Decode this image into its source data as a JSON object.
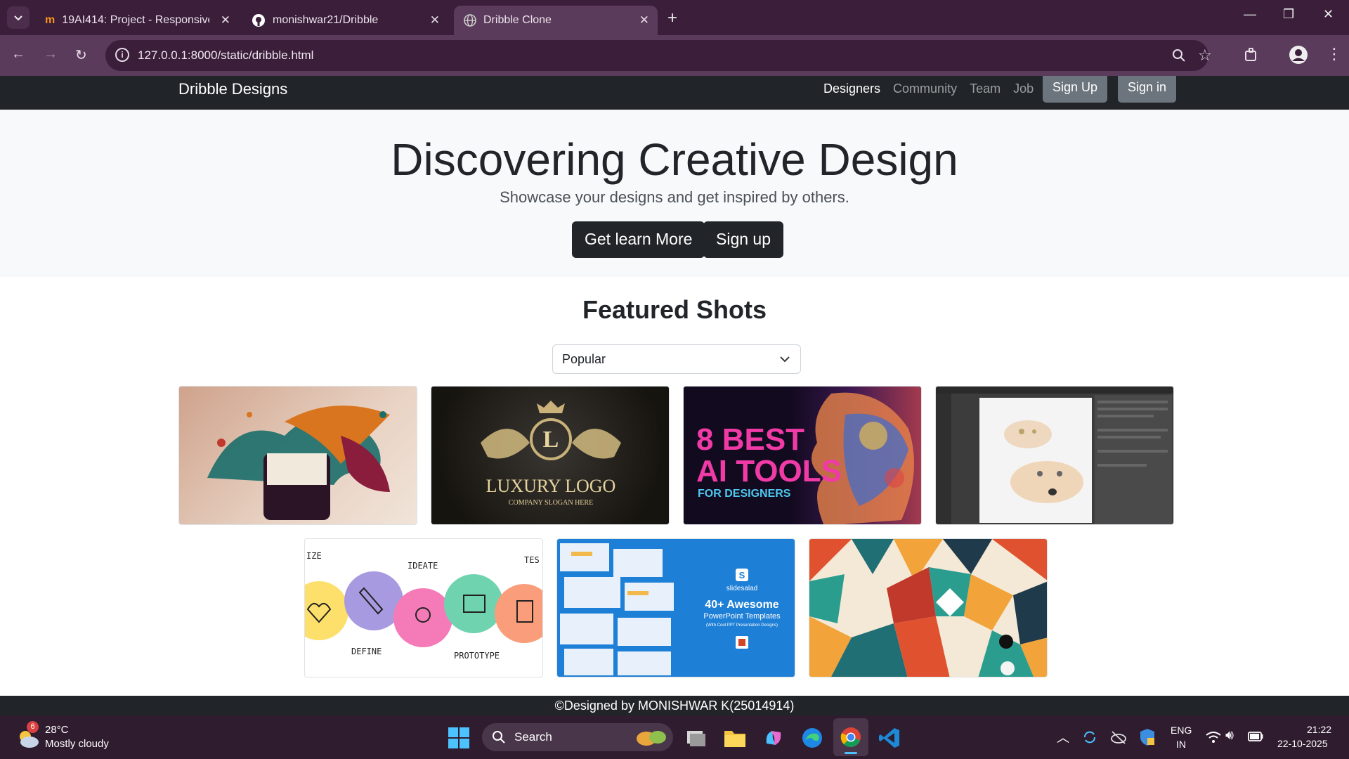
{
  "browser": {
    "tabs": [
      {
        "title": "19AI414: Project - Responsive W",
        "icon": "moodle-icon",
        "active": false
      },
      {
        "title": "monishwar21/Dribble",
        "icon": "github-icon",
        "active": false
      },
      {
        "title": "Dribble Clone",
        "icon": "globe-icon",
        "active": true
      }
    ],
    "url": "127.0.0.1:8000/static/dribble.html"
  },
  "navbar": {
    "brand": "Dribble Designs",
    "links": [
      "Designers",
      "Community",
      "Team",
      "Job"
    ],
    "signup": "Sign Up",
    "signin": "Sign in"
  },
  "hero": {
    "title": "Discovering Creative Design",
    "subtitle": "Showcase your designs and get inspired by others.",
    "learn_btn": "Get learn More",
    "signup_btn": "Sign up"
  },
  "featured": {
    "title": "Featured Shots",
    "sort_value": "Popular",
    "shots": [
      {
        "alt": "paint splash cup",
        "text": []
      },
      {
        "alt": "luxury logo",
        "text": [
          "LUXURY LOGO",
          "COMPANY SLOGAN HERE"
        ]
      },
      {
        "alt": "ai tools",
        "text": [
          "8 BEST",
          "AI TOOLS",
          "FOR DESIGNERS"
        ]
      },
      {
        "alt": "illustrator screenshot",
        "text": []
      },
      {
        "alt": "design thinking",
        "text": [
          "IDEATE",
          "DEFINE",
          "PROTOTYPE",
          "IZE",
          "TES"
        ]
      },
      {
        "alt": "slidesalad templates",
        "text": [
          "slidesalad",
          "40+ Awesome",
          "PowerPoint Templates",
          "(With Cool PPT Presentation Designs)"
        ]
      },
      {
        "alt": "geometric pattern",
        "text": []
      }
    ]
  },
  "footer": "©Designed by MONISHWAR K(25014914)",
  "taskbar": {
    "weather_temp": "28°C",
    "weather_desc": "Mostly cloudy",
    "weather_badge": "6",
    "search": "Search",
    "lang1": "ENG",
    "lang2": "IN",
    "time": "21:22",
    "date": "22-10-2025"
  }
}
